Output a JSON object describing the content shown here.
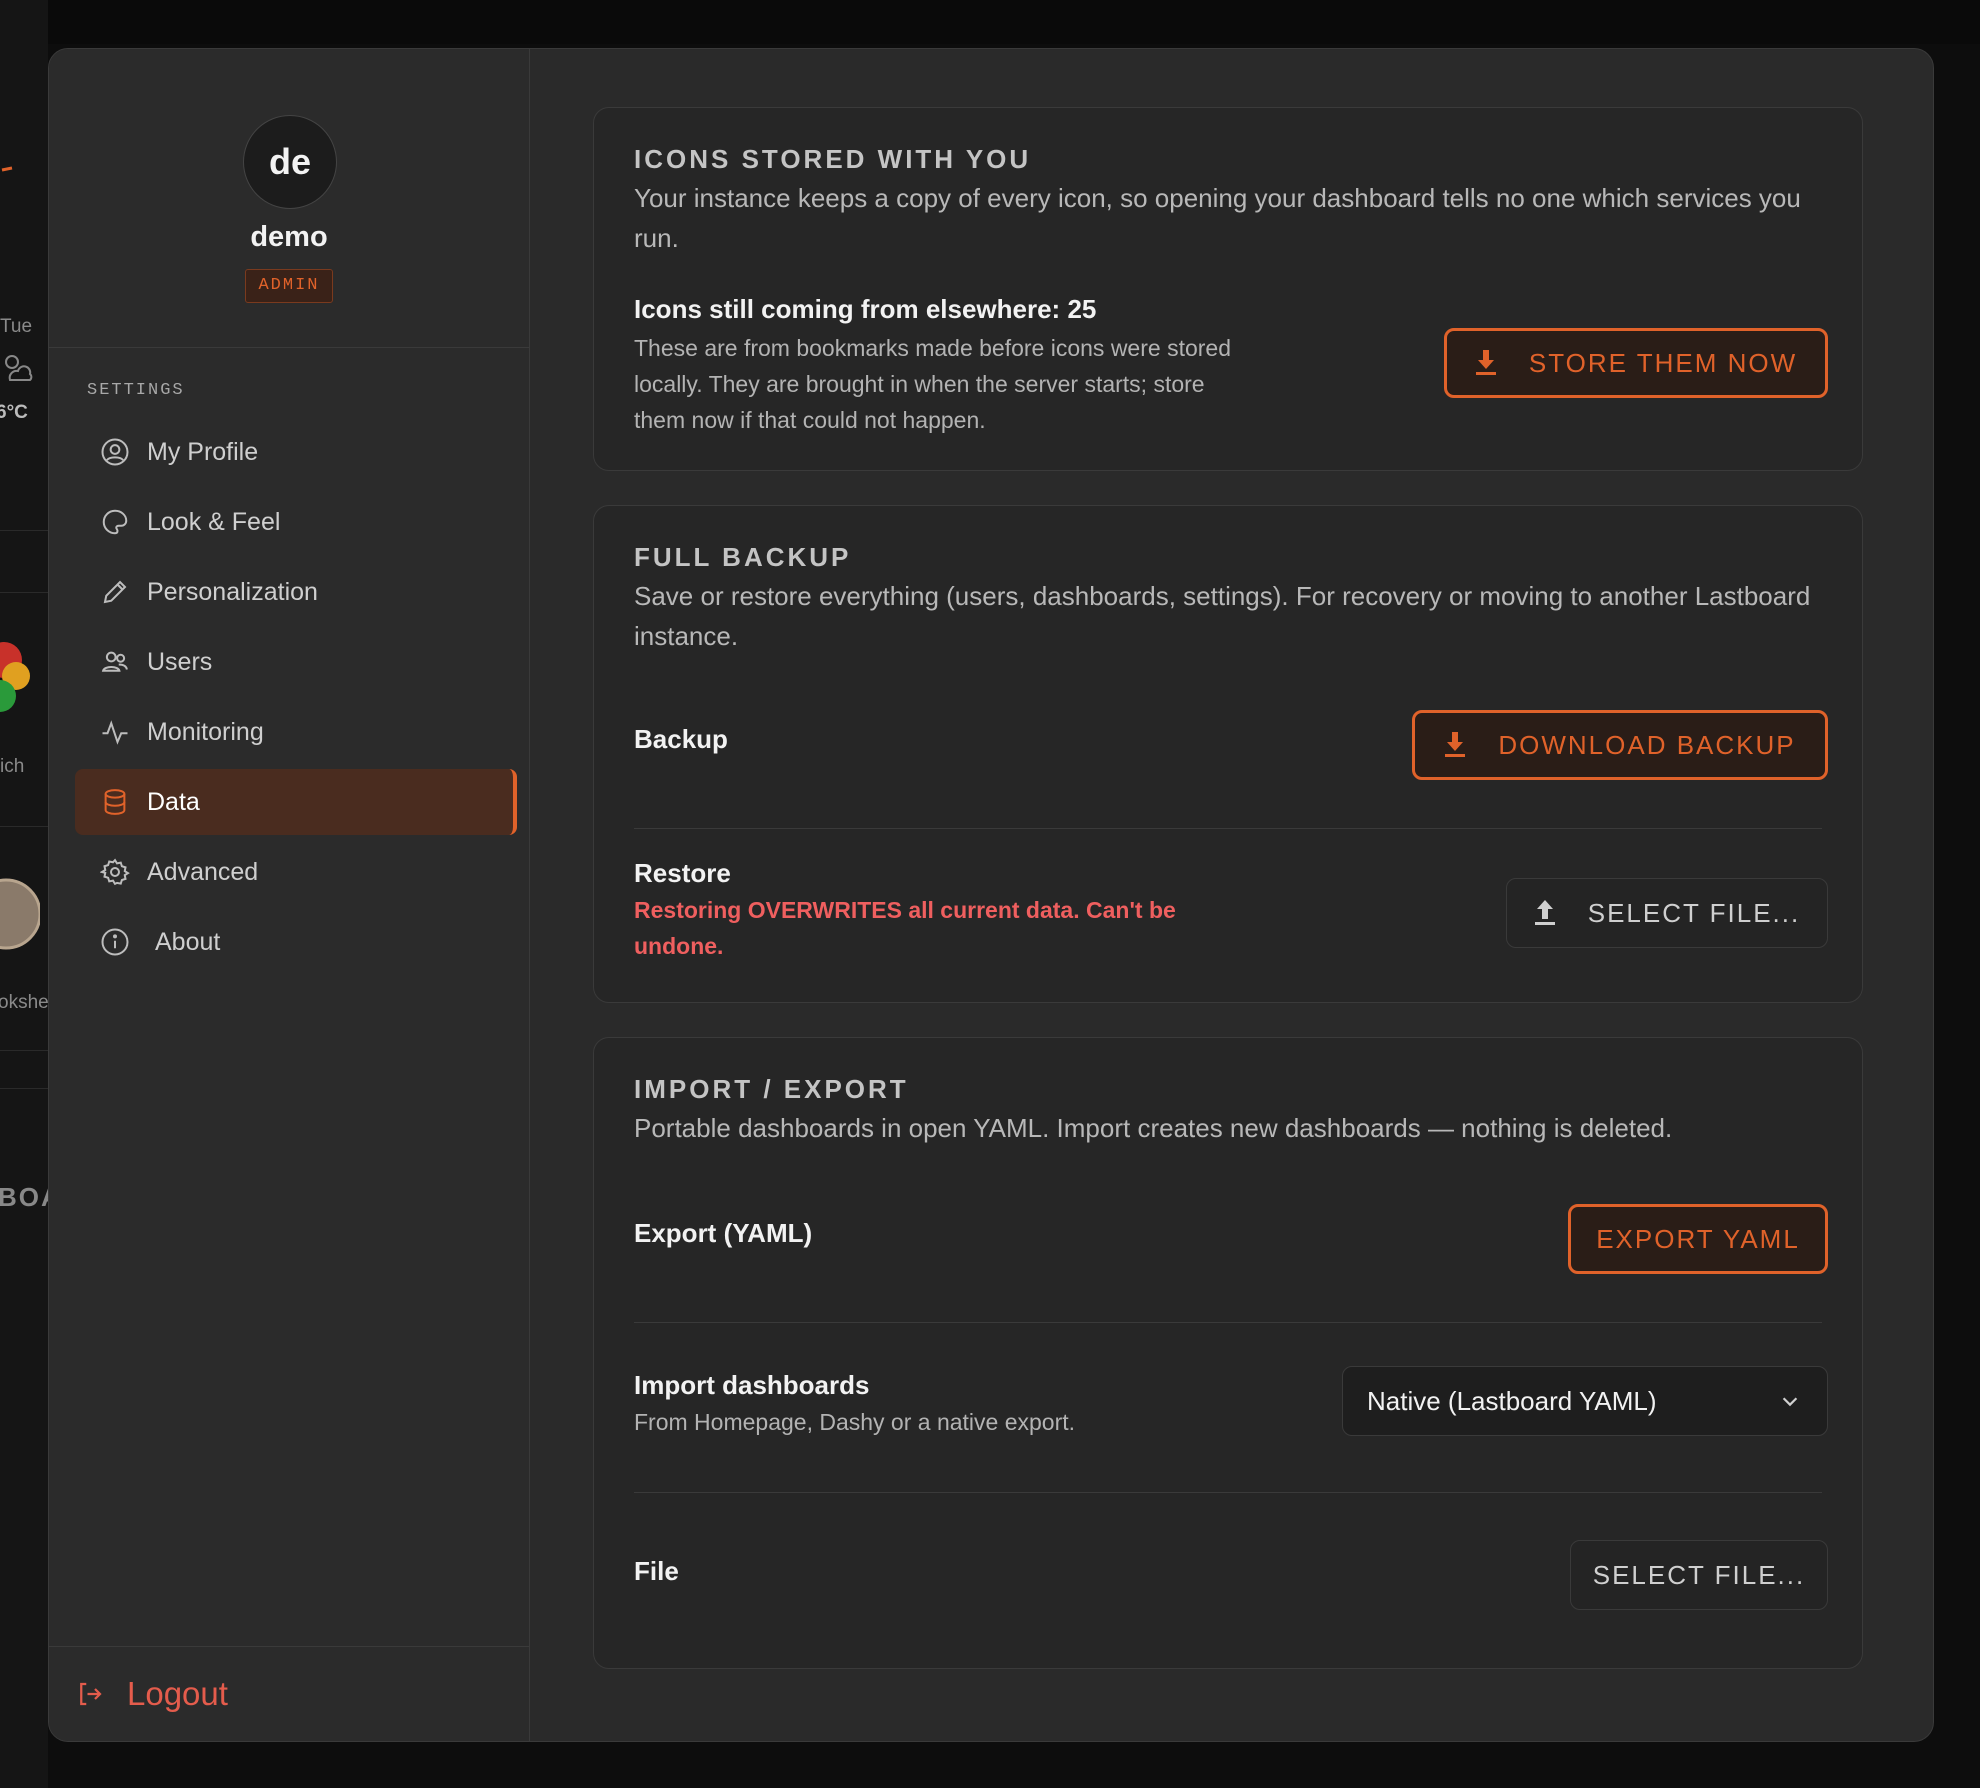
{
  "background": {
    "weather_day": "Tue",
    "weather_temp": "6°C",
    "app_label": "ich",
    "app_label_2": "okshe",
    "section_fragment": "BOA"
  },
  "profile": {
    "initials": "de",
    "name": "demo",
    "role": "ADMIN"
  },
  "sidebar": {
    "section_label": "SETTINGS",
    "items": [
      {
        "label": "My Profile",
        "icon": "user-circle-icon"
      },
      {
        "label": "Look & Feel",
        "icon": "palette-icon"
      },
      {
        "label": "Personalization",
        "icon": "pencil-icon"
      },
      {
        "label": "Users",
        "icon": "users-icon"
      },
      {
        "label": "Monitoring",
        "icon": "activity-icon"
      },
      {
        "label": "Data",
        "icon": "database-icon",
        "active": true
      },
      {
        "label": "Advanced",
        "icon": "gear-icon"
      },
      {
        "label": "About",
        "icon": "info-icon"
      }
    ],
    "logout_label": "Logout"
  },
  "icons_card": {
    "title": "ICONS STORED WITH YOU",
    "description": "Your instance keeps a copy of every icon, so opening your dashboard tells no one which services you run.",
    "count_label": "Icons still coming from elsewhere: 25",
    "count_desc": "These are from bookmarks made before icons were stored locally. They are brought in when the server starts; store them now if that could not happen.",
    "button_label": "STORE THEM NOW"
  },
  "backup_card": {
    "title": "FULL BACKUP",
    "description": "Save or restore everything (users, dashboards, settings). For recovery or moving to another Lastboard instance.",
    "backup_label": "Backup",
    "download_button": "DOWNLOAD BACKUP",
    "restore_label": "Restore",
    "restore_warning": "Restoring OVERWRITES all current data. Can't be undone.",
    "select_file_button": "SELECT FILE..."
  },
  "import_card": {
    "title": "IMPORT / EXPORT",
    "description": "Portable dashboards in open YAML. Import creates new dashboards — nothing is deleted.",
    "export_label": "Export (YAML)",
    "export_button": "EXPORT YAML",
    "import_label": "Import dashboards",
    "import_sub": "From Homepage, Dashy or a native export.",
    "import_format_selected": "Native (Lastboard YAML)",
    "file_label": "File",
    "file_button": "SELECT FILE..."
  },
  "colors": {
    "accent": "#e0622a",
    "danger": "#ef5f5f",
    "card_bg": "#262626",
    "modal_bg": "#2a2a2a"
  }
}
